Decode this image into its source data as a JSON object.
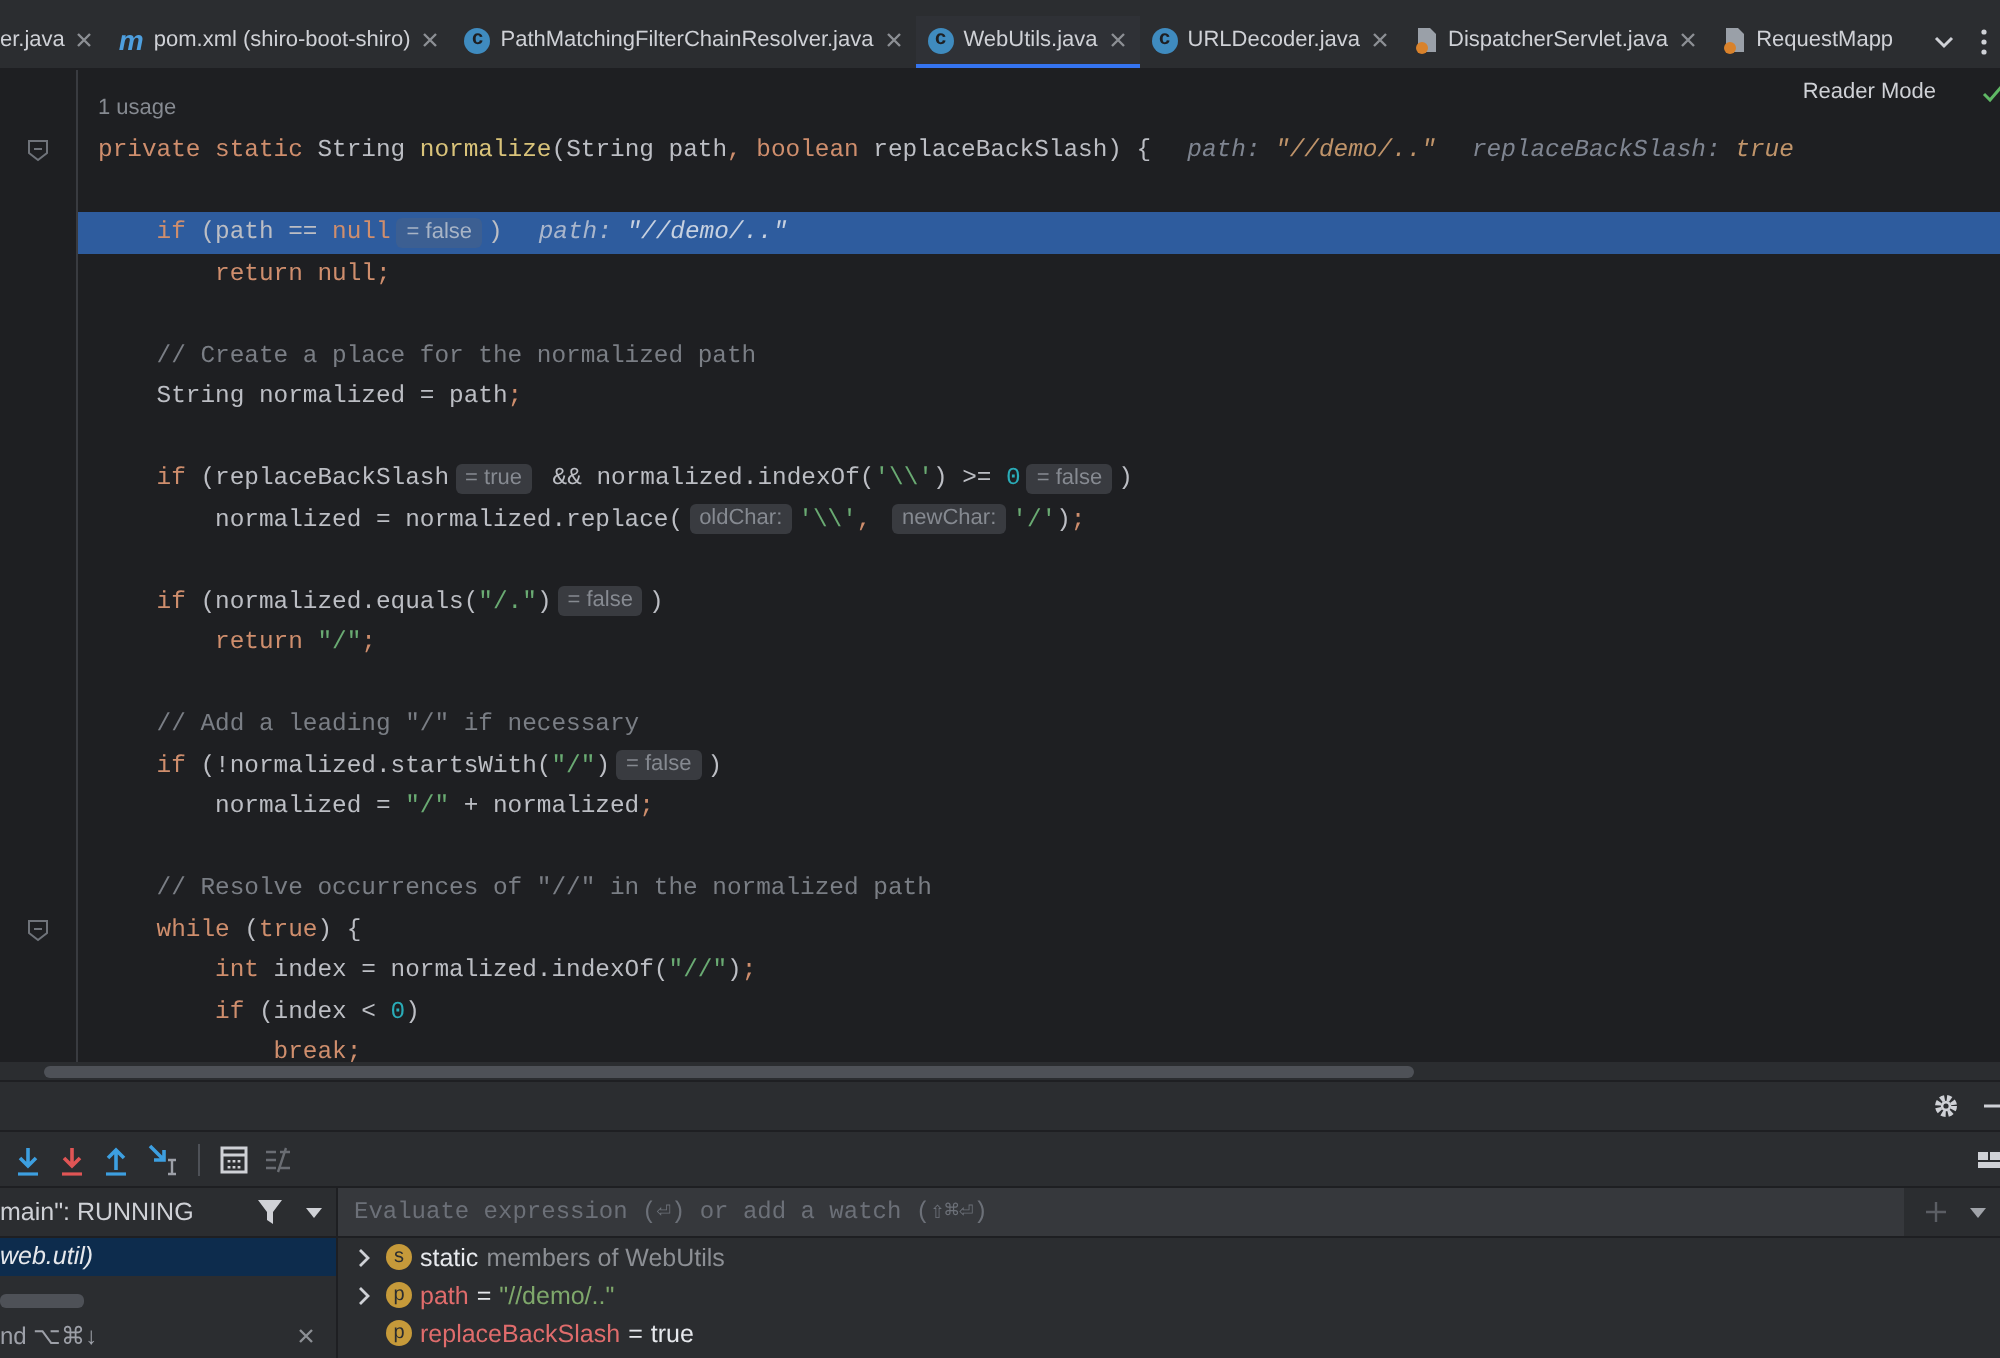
{
  "tabs": [
    {
      "label": "er.java",
      "kind": "plain",
      "selected": false,
      "closable": true
    },
    {
      "label": "pom.xml (shiro-boot-shiro)",
      "kind": "maven",
      "icon_text": "m",
      "selected": false,
      "closable": true
    },
    {
      "label": "PathMatchingFilterChainResolver.java",
      "kind": "class",
      "icon_text": "c",
      "selected": false,
      "closable": true
    },
    {
      "label": "WebUtils.java",
      "kind": "class",
      "icon_text": "c",
      "selected": true,
      "closable": true
    },
    {
      "label": "URLDecoder.java",
      "kind": "class",
      "icon_text": "c",
      "selected": false,
      "closable": true
    },
    {
      "label": "DispatcherServlet.java",
      "kind": "compiled",
      "selected": false,
      "closable": true
    },
    {
      "label": "RequestMapp",
      "kind": "compiled",
      "selected": false,
      "closable": false
    }
  ],
  "editor": {
    "reader_mode": "Reader Mode",
    "usage": "1 usage",
    "lines": [
      {
        "fold": true,
        "selected": false,
        "tokens": [
          {
            "kind": "kw",
            "text": "private static "
          },
          {
            "kind": "txt",
            "text": "String "
          },
          {
            "kind": "decl",
            "text": "normalize"
          },
          {
            "kind": "txt",
            "text": "(String path"
          },
          {
            "kind": "kw",
            "text": ", boolean "
          },
          {
            "kind": "txt",
            "text": "replaceBackSlash) {"
          },
          {
            "kind": "debug",
            "name": "path: ",
            "value": "\"//demo/..\""
          },
          {
            "kind": "debug",
            "name": "replaceBackSlash: ",
            "value": "true"
          }
        ]
      },
      {
        "fold": false,
        "selected": false
      },
      {
        "fold": false,
        "selected": true,
        "tokens": [
          {
            "kind": "kw",
            "text": "    if "
          },
          {
            "kind": "txt",
            "text": "(path == "
          },
          {
            "kind": "kw",
            "text": "null"
          },
          {
            "kind": "hint",
            "text": "= false"
          },
          {
            "kind": "txt",
            "text": ")"
          },
          {
            "kind": "debug",
            "name": "path: ",
            "value": "\"//demo/..\""
          }
        ]
      },
      {
        "fold": false,
        "selected": false,
        "tokens": [
          {
            "kind": "kw",
            "text": "        return null;"
          }
        ]
      },
      {
        "fold": false,
        "selected": false
      },
      {
        "fold": false,
        "selected": false,
        "tokens": [
          {
            "kind": "com",
            "text": "    // Create a place for the normalized path"
          }
        ]
      },
      {
        "fold": false,
        "selected": false,
        "tokens": [
          {
            "kind": "txt",
            "text": "    String normalized = path"
          },
          {
            "kind": "kw",
            "text": ";"
          }
        ]
      },
      {
        "fold": false,
        "selected": false
      },
      {
        "fold": false,
        "selected": false,
        "tokens": [
          {
            "kind": "kw",
            "text": "    if "
          },
          {
            "kind": "txt",
            "text": "(replaceBackSlash"
          },
          {
            "kind": "hint",
            "text": "= true"
          },
          {
            "kind": "txt",
            "text": " && normalized.indexOf("
          },
          {
            "kind": "str",
            "text": "'\\\\'"
          },
          {
            "kind": "txt",
            "text": ") >= "
          },
          {
            "kind": "num",
            "text": "0"
          },
          {
            "kind": "hint",
            "text": "= false"
          },
          {
            "kind": "txt",
            "text": ")"
          }
        ]
      },
      {
        "fold": false,
        "selected": false,
        "tokens": [
          {
            "kind": "txt",
            "text": "        normalized = normalized.replace("
          },
          {
            "kind": "param",
            "text": "oldChar:"
          },
          {
            "kind": "str",
            "text": "'\\\\'"
          },
          {
            "kind": "kw",
            "text": ", "
          },
          {
            "kind": "param",
            "text": "newChar:"
          },
          {
            "kind": "str",
            "text": "'/'"
          },
          {
            "kind": "txt",
            "text": ")"
          },
          {
            "kind": "kw",
            "text": ";"
          }
        ]
      },
      {
        "fold": false,
        "selected": false
      },
      {
        "fold": false,
        "selected": false,
        "tokens": [
          {
            "kind": "kw",
            "text": "    if "
          },
          {
            "kind": "txt",
            "text": "(normalized.equals("
          },
          {
            "kind": "str",
            "text": "\"/.\""
          },
          {
            "kind": "txt",
            "text": ")"
          },
          {
            "kind": "hint",
            "text": "= false"
          },
          {
            "kind": "txt",
            "text": ")"
          }
        ]
      },
      {
        "fold": false,
        "selected": false,
        "tokens": [
          {
            "kind": "kw",
            "text": "        return "
          },
          {
            "kind": "str",
            "text": "\"/\""
          },
          {
            "kind": "kw",
            "text": ";"
          }
        ]
      },
      {
        "fold": false,
        "selected": false
      },
      {
        "fold": false,
        "selected": false,
        "tokens": [
          {
            "kind": "com",
            "text": "    // Add a leading \"/\" if necessary"
          }
        ]
      },
      {
        "fold": false,
        "selected": false,
        "tokens": [
          {
            "kind": "kw",
            "text": "    if "
          },
          {
            "kind": "txt",
            "text": "(!normalized.startsWith("
          },
          {
            "kind": "str",
            "text": "\"/\""
          },
          {
            "kind": "txt",
            "text": ")"
          },
          {
            "kind": "hint",
            "text": "= false"
          },
          {
            "kind": "txt",
            "text": ")"
          }
        ]
      },
      {
        "fold": false,
        "selected": false,
        "tokens": [
          {
            "kind": "txt",
            "text": "        normalized = "
          },
          {
            "kind": "str",
            "text": "\"/\""
          },
          {
            "kind": "txt",
            "text": " + normalized"
          },
          {
            "kind": "kw",
            "text": ";"
          }
        ]
      },
      {
        "fold": false,
        "selected": false
      },
      {
        "fold": false,
        "selected": false,
        "tokens": [
          {
            "kind": "com",
            "text": "    // Resolve occurrences of \"//\" in the normalized path"
          }
        ]
      },
      {
        "fold": true,
        "selected": false,
        "tokens": [
          {
            "kind": "kw",
            "text": "    while "
          },
          {
            "kind": "txt",
            "text": "("
          },
          {
            "kind": "kw",
            "text": "true"
          },
          {
            "kind": "txt",
            "text": ") {"
          }
        ]
      },
      {
        "fold": false,
        "selected": false,
        "tokens": [
          {
            "kind": "kw",
            "text": "        int "
          },
          {
            "kind": "txt",
            "text": "index = normalized.indexOf("
          },
          {
            "kind": "str",
            "text": "\"//\""
          },
          {
            "kind": "txt",
            "text": ")"
          },
          {
            "kind": "kw",
            "text": ";"
          }
        ]
      },
      {
        "fold": false,
        "selected": false,
        "tokens": [
          {
            "kind": "kw",
            "text": "        if "
          },
          {
            "kind": "txt",
            "text": "(index < "
          },
          {
            "kind": "num",
            "text": "0"
          },
          {
            "kind": "txt",
            "text": ")"
          }
        ]
      },
      {
        "fold": false,
        "selected": false,
        "tokens": [
          {
            "kind": "kw",
            "text": "            break;"
          }
        ]
      }
    ]
  },
  "debugger": {
    "thread": "main\": RUNNING",
    "frames": [
      {
        "text": "web.util)",
        "selected": true
      }
    ],
    "shortcut": "nd ⌥⌘↓",
    "evaluate": {
      "placeholder": "Evaluate expression (⏎) or add a watch (⇧⌘⏎)"
    },
    "variables": [
      {
        "kind": "group",
        "badge": "s",
        "name": "static",
        "detail": "members of WebUtils",
        "expandable": true
      },
      {
        "kind": "string",
        "badge": "p",
        "name": "path",
        "operator": "=",
        "value": "\"//demo/..\"",
        "expandable": true
      },
      {
        "kind": "boolean",
        "badge": "p",
        "name": "replaceBackSlash",
        "operator": "=",
        "value": "true",
        "expandable": false
      }
    ]
  }
}
